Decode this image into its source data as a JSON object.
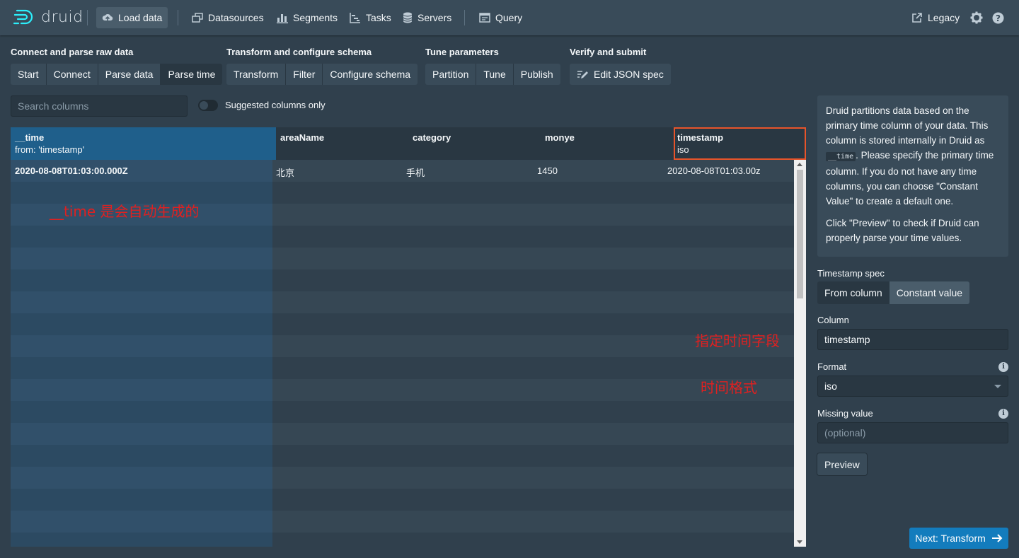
{
  "app": {
    "logo_text": "druid"
  },
  "nav": {
    "items": [
      {
        "label": "Load data",
        "icon": "cloud-upload-icon",
        "active": true
      },
      {
        "label": "Datasources",
        "icon": "multi-select-icon"
      },
      {
        "label": "Segments",
        "icon": "stacked-chart-icon"
      },
      {
        "label": "Tasks",
        "icon": "gantt-chart-icon"
      },
      {
        "label": "Servers",
        "icon": "database-icon"
      },
      {
        "label": "Query",
        "icon": "application-icon"
      }
    ],
    "legacy_label": "Legacy"
  },
  "steps": {
    "groups": [
      {
        "label": "Connect and parse raw data",
        "items": [
          "Start",
          "Connect",
          "Parse data",
          "Parse time"
        ]
      },
      {
        "label": "Transform and configure schema",
        "items": [
          "Transform",
          "Filter",
          "Configure schema"
        ]
      },
      {
        "label": "Tune parameters",
        "items": [
          "Partition",
          "Tune",
          "Publish"
        ]
      },
      {
        "label": "Verify and submit",
        "items": [
          "Edit JSON spec"
        ]
      }
    ],
    "active": "Parse time"
  },
  "search": {
    "placeholder": "Search columns",
    "value": ""
  },
  "suggested_switch": {
    "label": "Suggested columns only",
    "on": false
  },
  "table": {
    "columns": [
      {
        "name": "__time",
        "sub": "from: 'timestamp'"
      },
      {
        "name": "areaName",
        "sub": ""
      },
      {
        "name": "category",
        "sub": ""
      },
      {
        "name": "monye",
        "sub": ""
      },
      {
        "name": "timestamp",
        "sub": "iso"
      }
    ],
    "rows": [
      [
        "2020-08-08T01:03:00.000Z",
        "北京",
        "手机",
        "1450",
        "2020-08-08T01:03.00z"
      ]
    ]
  },
  "annotations": {
    "time_note": "__time 是会自动生成的",
    "column_note": "指定时间字段",
    "format_note": "时间格式"
  },
  "panel": {
    "callout_p1_a": "Druid partitions data based on the primary time column of your data. This column is stored internally in Druid as ",
    "callout_code": "__time",
    "callout_p1_b": ". Please specify the primary time column. If you do not have any time columns, you can choose \"Constant Value\" to create a default one.",
    "callout_p2": "Click \"Preview\" to check if Druid can properly parse your time values.",
    "timestamp_spec_label": "Timestamp spec",
    "timestamp_spec_options": [
      "From column",
      "Constant value"
    ],
    "timestamp_spec_selected": "From column",
    "column_label": "Column",
    "column_value": "timestamp",
    "format_label": "Format",
    "format_value": "iso",
    "missing_label": "Missing value",
    "missing_placeholder": "(optional)",
    "preview_label": "Preview",
    "next_label": "Next: Transform"
  },
  "colors": {
    "accent": "#137cbd",
    "selected_outline": "#e8542a",
    "annotation": "#e02020"
  }
}
